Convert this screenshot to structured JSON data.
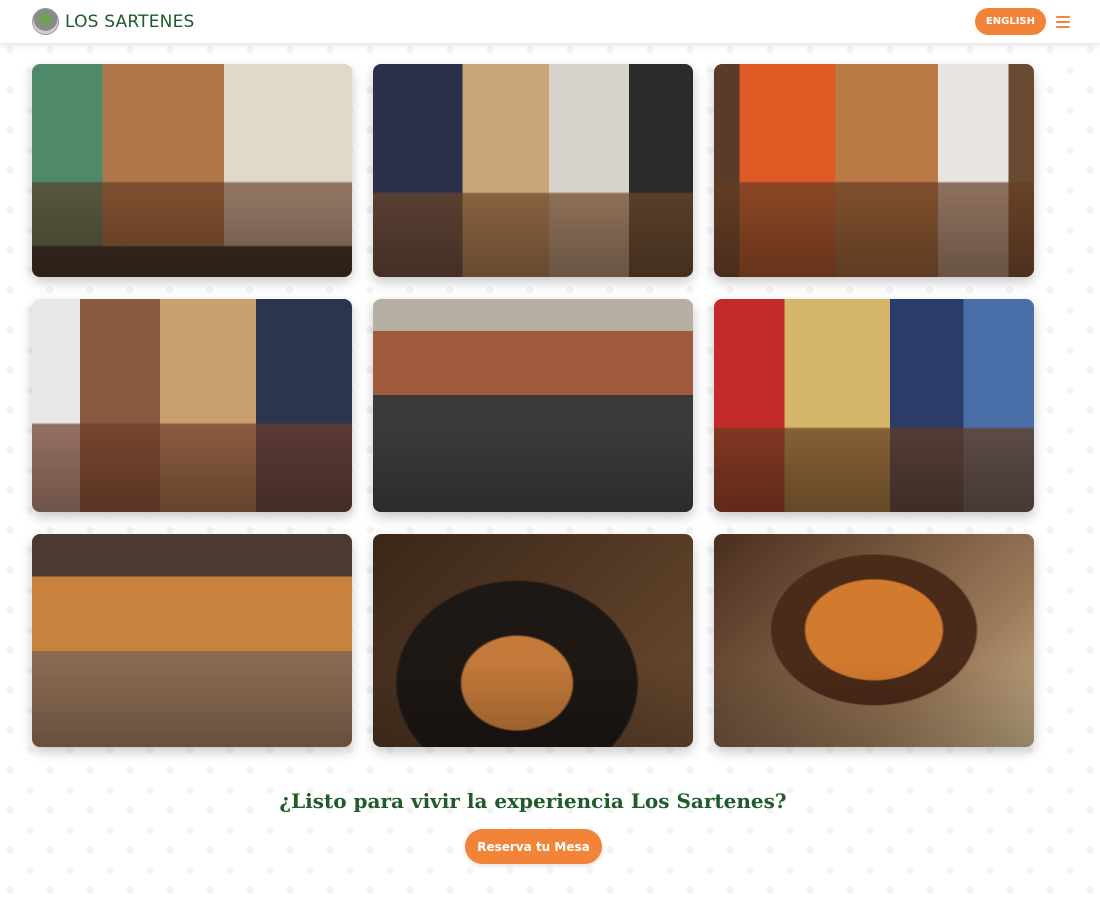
{
  "header": {
    "brand_name": "LOS SARTENES",
    "language_button": "ENGLISH",
    "menu_icon": "hamburger-menu-icon"
  },
  "gallery": {
    "photos": [
      {
        "description_icon": "photo"
      },
      {
        "description_icon": "photo"
      },
      {
        "description_icon": "photo"
      },
      {
        "description_icon": "photo"
      },
      {
        "description_icon": "photo"
      },
      {
        "description_icon": "photo"
      },
      {
        "description_icon": "photo"
      },
      {
        "description_icon": "photo"
      },
      {
        "description_icon": "photo"
      }
    ]
  },
  "cta": {
    "title": "¿Listo para vivir la experiencia Los Sartenes?",
    "button": "Reserva tu Mesa"
  },
  "colors": {
    "brand_green": "#1f5b2b",
    "accent_orange": "#f2843a"
  }
}
